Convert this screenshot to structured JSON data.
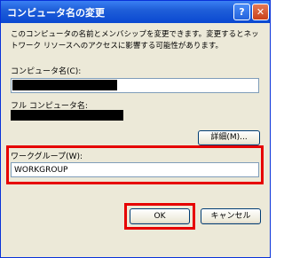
{
  "window": {
    "title": "コンピュータ名の変更",
    "help_label": "?",
    "close_label": "✕"
  },
  "description": "このコンピュータの名前とメンバシップを変更できます。変更するとネットワーク リソースへのアクセスに影響する可能性があります。",
  "computer_name": {
    "label": "コンピュータ名(C):",
    "value": ""
  },
  "full_computer_name": {
    "label": "フル コンピュータ名:"
  },
  "details_button": "詳細(M)...",
  "workgroup": {
    "label": "ワークグループ(W):",
    "value": "WORKGROUP"
  },
  "buttons": {
    "ok": "OK",
    "cancel": "キャンセル"
  },
  "colors": {
    "highlight": "#e60000",
    "titlebar": "#0a48d1"
  }
}
